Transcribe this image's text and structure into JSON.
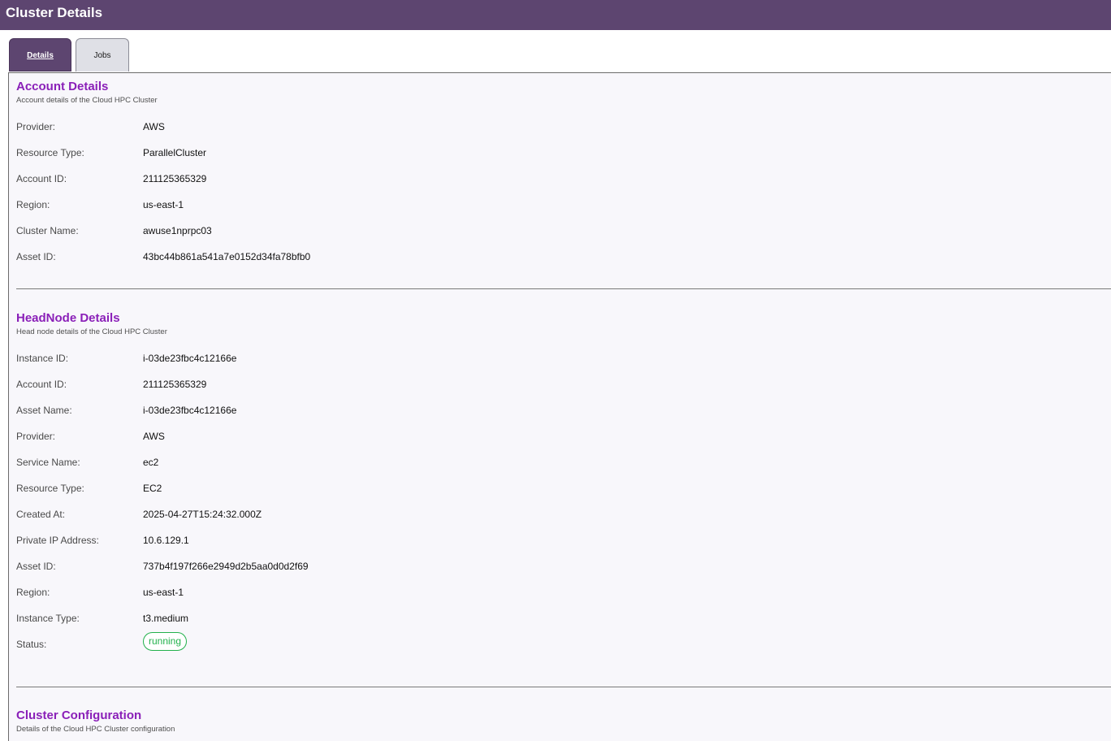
{
  "header": {
    "title": "Cluster Details"
  },
  "tabs": [
    {
      "label": "Details",
      "active": true
    },
    {
      "label": "Jobs",
      "active": false
    }
  ],
  "account": {
    "title": "Account Details",
    "description": "Account details of the Cloud HPC Cluster",
    "fields": [
      {
        "label": "Provider:",
        "value": "AWS"
      },
      {
        "label": "Resource Type:",
        "value": "ParallelCluster"
      },
      {
        "label": "Account ID:",
        "value": "211125365329"
      },
      {
        "label": "Region:",
        "value": "us-east-1"
      },
      {
        "label": "Cluster Name:",
        "value": "awuse1nprpc03"
      },
      {
        "label": "Asset ID:",
        "value": "43bc44b861a541a7e0152d34fa78bfb0"
      }
    ]
  },
  "headnode": {
    "title": "HeadNode Details",
    "description": "Head node details of the Cloud HPC Cluster",
    "fields": [
      {
        "label": "Instance ID:",
        "value": "i-03de23fbc4c12166e"
      },
      {
        "label": "Account ID:",
        "value": "211125365329"
      },
      {
        "label": "Asset Name:",
        "value": "i-03de23fbc4c12166e"
      },
      {
        "label": "Provider:",
        "value": "AWS"
      },
      {
        "label": "Service Name:",
        "value": "ec2"
      },
      {
        "label": "Resource Type:",
        "value": "EC2"
      },
      {
        "label": "Created At:",
        "value": "2025-04-27T15:24:32.000Z"
      },
      {
        "label": "Private IP Address:",
        "value": "10.6.129.1"
      },
      {
        "label": "Asset ID:",
        "value": "737b4f197f266e2949d2b5aa0d0d2f69"
      },
      {
        "label": "Region:",
        "value": "us-east-1"
      },
      {
        "label": "Instance Type:",
        "value": "t3.medium"
      },
      {
        "label": "Status:",
        "value": "running"
      }
    ]
  },
  "config": {
    "title": "Cluster Configuration",
    "description": "Details of the Cloud HPC Cluster configuration"
  },
  "colors": {
    "header_bg": "#5d4570",
    "section_title": "#8a1fb8",
    "status_running": "#22b14c"
  }
}
